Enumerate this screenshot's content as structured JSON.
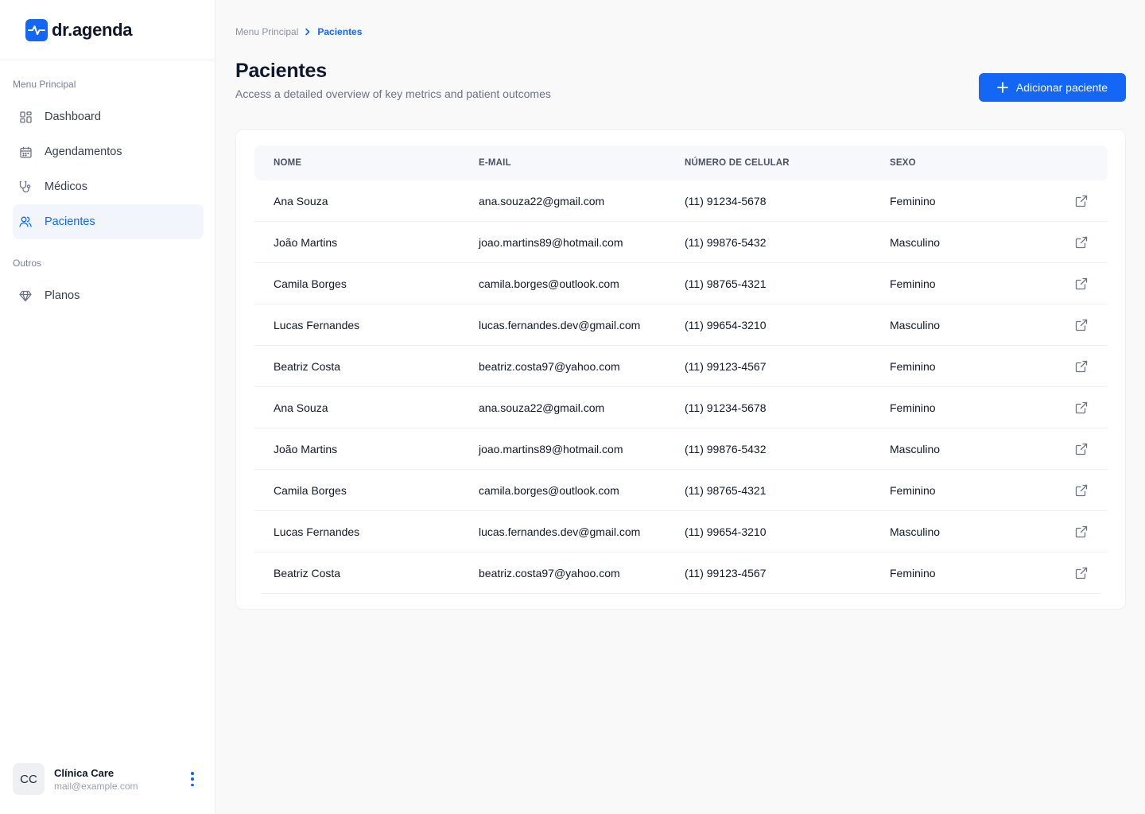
{
  "brand": {
    "name": "dr.agenda",
    "color": "#1466f5"
  },
  "sidebar": {
    "section_main": "Menu Principal",
    "main_items": [
      {
        "label": "Dashboard",
        "icon": "dashboard-icon"
      },
      {
        "label": "Agendamentos",
        "icon": "calendar-icon"
      },
      {
        "label": "Médicos",
        "icon": "stethoscope-icon"
      },
      {
        "label": "Pacientes",
        "icon": "users-icon",
        "active": true
      }
    ],
    "section_other": "Outros",
    "other_items": [
      {
        "label": "Planos",
        "icon": "diamond-icon"
      }
    ]
  },
  "user": {
    "initials": "CC",
    "name": "Clínica Care",
    "email": "mail@example.com"
  },
  "breadcrumb": {
    "root": "Menu Principal",
    "current": "Pacientes"
  },
  "page": {
    "title": "Pacientes",
    "subtitle": "Access a detailed overview of key metrics and patient outcomes",
    "add_button": "Adicionar paciente"
  },
  "table": {
    "headers": {
      "name": "NOME",
      "email": "E-MAIL",
      "phone": "NÚMERO DE CELULAR",
      "sex": "SEXO"
    },
    "rows": [
      {
        "name": "Ana Souza",
        "email": "ana.souza22@gmail.com",
        "phone": "(11) 91234-5678",
        "sex": "Feminino"
      },
      {
        "name": "João Martins",
        "email": "joao.martins89@hotmail.com",
        "phone": "(11) 99876-5432",
        "sex": "Masculino"
      },
      {
        "name": "Camila Borges",
        "email": "camila.borges@outlook.com",
        "phone": "(11) 98765-4321",
        "sex": "Feminino"
      },
      {
        "name": "Lucas Fernandes",
        "email": "lucas.fernandes.dev@gmail.com",
        "phone": "(11) 99654-3210",
        "sex": "Masculino"
      },
      {
        "name": "Beatriz Costa",
        "email": "beatriz.costa97@yahoo.com",
        "phone": "(11) 99123-4567",
        "sex": "Feminino"
      },
      {
        "name": "Ana Souza",
        "email": "ana.souza22@gmail.com",
        "phone": "(11) 91234-5678",
        "sex": "Feminino"
      },
      {
        "name": "João Martins",
        "email": "joao.martins89@hotmail.com",
        "phone": "(11) 99876-5432",
        "sex": "Masculino"
      },
      {
        "name": "Camila Borges",
        "email": "camila.borges@outlook.com",
        "phone": "(11) 98765-4321",
        "sex": "Feminino"
      },
      {
        "name": "Lucas Fernandes",
        "email": "lucas.fernandes.dev@gmail.com",
        "phone": "(11) 99654-3210",
        "sex": "Masculino"
      },
      {
        "name": "Beatriz Costa",
        "email": "beatriz.costa97@yahoo.com",
        "phone": "(11) 99123-4567",
        "sex": "Feminino"
      }
    ]
  }
}
